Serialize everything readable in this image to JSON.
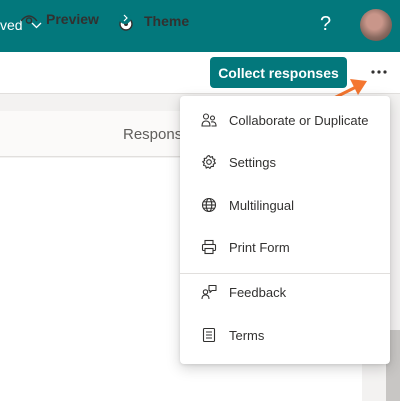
{
  "header": {
    "saved_label": "ved",
    "help_label": "?"
  },
  "toolbar": {
    "preview_label": "Preview",
    "theme_label": "Theme",
    "collect_label": "Collect responses",
    "more_label": "···"
  },
  "tabs": {
    "responses_label": "Respons"
  },
  "colors": {
    "brand": "#03787c",
    "annotation_arrow": "#f47630"
  },
  "menu": {
    "items": [
      {
        "label": "Collaborate or Duplicate",
        "icon": "people-icon"
      },
      {
        "label": "Settings",
        "icon": "gear-icon"
      },
      {
        "label": "Multilingual",
        "icon": "globe-icon"
      },
      {
        "label": "Print Form",
        "icon": "printer-icon"
      },
      {
        "label": "Feedback",
        "icon": "feedback-icon"
      },
      {
        "label": "Terms",
        "icon": "document-icon"
      }
    ]
  }
}
